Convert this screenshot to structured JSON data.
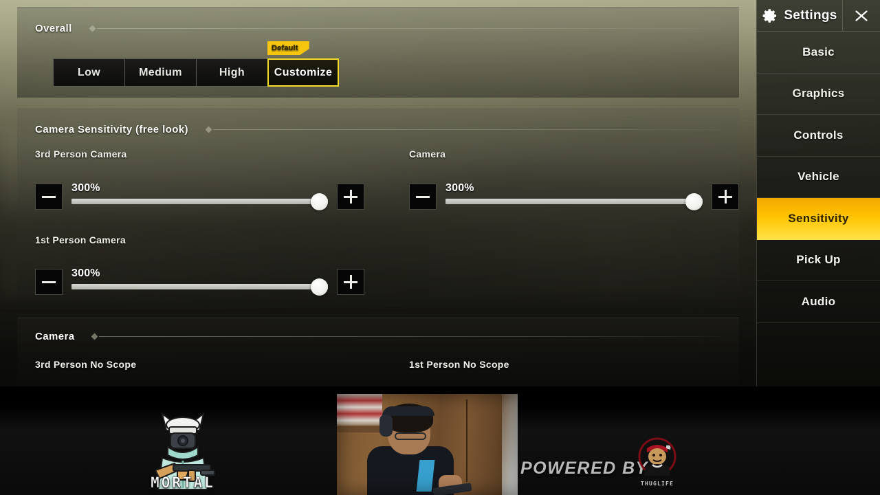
{
  "sections": {
    "overall": {
      "title": "Overall",
      "presets": [
        {
          "label": "Low",
          "selected": false,
          "tag": ""
        },
        {
          "label": "Medium",
          "selected": false,
          "tag": ""
        },
        {
          "label": "High",
          "selected": false,
          "tag": ""
        },
        {
          "label": "Customize",
          "selected": true,
          "tag": "Default"
        }
      ]
    },
    "camera_sensitivity": {
      "title": "Camera Sensitivity (free look)",
      "controls": [
        {
          "label": "3rd Person Camera",
          "value": "300%",
          "percent": 100,
          "minus": "minus-icon",
          "plus": "plus-icon"
        },
        {
          "label": "Camera",
          "value": "300%",
          "percent": 100,
          "minus": "minus-icon",
          "plus": "plus-icon"
        },
        {
          "label": "1st Person Camera",
          "value": "300%",
          "percent": 100,
          "minus": "minus-icon",
          "plus": "plus-icon"
        }
      ]
    },
    "camera": {
      "title": "Camera",
      "sub_labels": [
        "3rd Person No Scope",
        "1st Person No Scope"
      ]
    }
  },
  "sidebar": {
    "title": "Settings",
    "gear_icon": "gear-icon",
    "close_icon": "close-icon",
    "items": [
      {
        "label": "Basic",
        "active": false
      },
      {
        "label": "Graphics",
        "active": false
      },
      {
        "label": "Controls",
        "active": false
      },
      {
        "label": "Vehicle",
        "active": false
      },
      {
        "label": "Sensitivity",
        "active": true
      },
      {
        "label": "Pick Up",
        "active": false
      },
      {
        "label": "Audio",
        "active": false
      }
    ],
    "active_color": "#ffc400"
  },
  "overlay": {
    "brand_name": "MORTAL",
    "powered_by": "POWERED BY",
    "sponsor_name": "THUGLIFE"
  }
}
